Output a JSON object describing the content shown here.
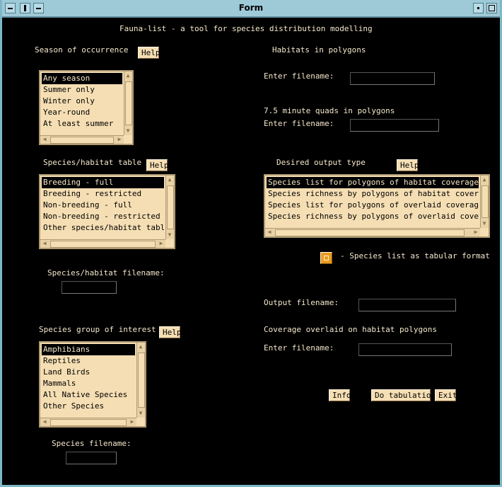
{
  "window": {
    "title": "Form"
  },
  "app_title": "Fauna-list - a tool for species distribution modelling",
  "help_label": "Help",
  "season": {
    "label": "Season of occurrence",
    "items": [
      "Any season",
      "Summer only",
      "Winter only",
      "Year-round",
      "At least summer"
    ],
    "selected": "Any season"
  },
  "habitat_table": {
    "label": "Species/habitat table",
    "items": [
      "Breeding - full",
      "Breeding - restricted",
      "Non-breeding - full",
      "Non-breeding - restricted",
      "Other species/habitat table"
    ],
    "selected": "Breeding - full"
  },
  "habitat_filename": {
    "label": "Species/habitat filename:",
    "value": ""
  },
  "species_group": {
    "label": "Species group of interest",
    "items": [
      "Amphibians",
      "Reptiles",
      "Land Birds",
      "Mammals",
      "All Native Species",
      "Other Species"
    ],
    "selected": "Amphibians"
  },
  "species_filename": {
    "label": "Species filename:",
    "value": ""
  },
  "habitats_polygons": {
    "label": "Habitats in polygons",
    "enter_label": "Enter filename:",
    "value": ""
  },
  "quads": {
    "label": "7.5 minute quads in polygons",
    "enter_label": "Enter filename:",
    "value": ""
  },
  "output_type": {
    "label": "Desired output type",
    "items": [
      "Species list for polygons of habitat coverage",
      "Species richness by polygons of habitat coverage",
      "Species list for polygons of overlaid coverage",
      "Species richness by polygons of overlaid coverage"
    ],
    "selected": "Species list for polygons of habitat coverage"
  },
  "tabular": {
    "label": "- Species list as tabular format",
    "checked": true
  },
  "output_filename": {
    "label": "Output filename:",
    "value": ""
  },
  "overlay": {
    "label": "Coverage overlaid on habitat polygons",
    "enter_label": "Enter filename:",
    "value": ""
  },
  "buttons": {
    "info": "Info",
    "tabulate": "Do tabulation",
    "exit": "Exit"
  },
  "colors": {
    "background": "#000000",
    "panel": "#f5deb3",
    "text": "#f5e8cc",
    "titlebar": "#9ec9d6",
    "toggle": "#e89a20"
  }
}
